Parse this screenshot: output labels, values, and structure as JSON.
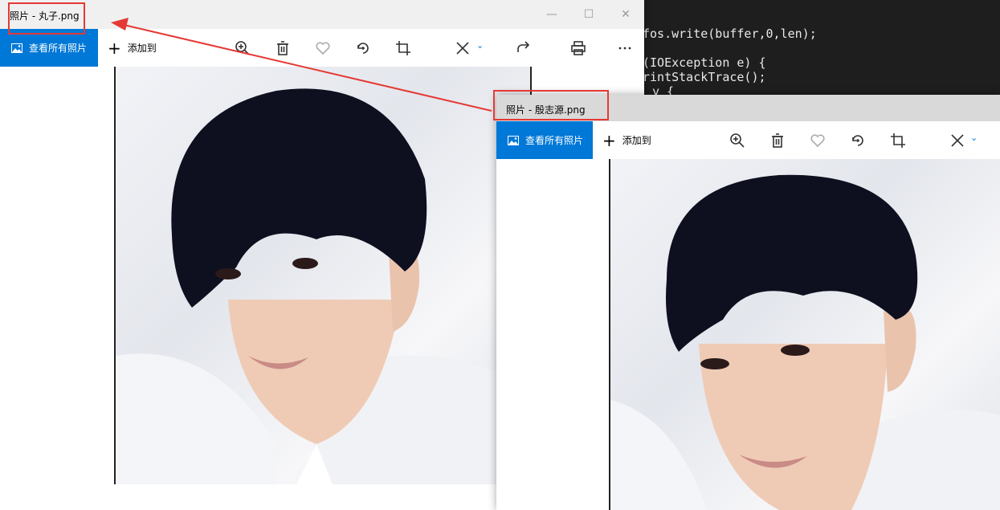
{
  "background_code": {
    "lines": [
      "fos.write(buffer,0,len);",
      "",
      "(IOException e) {",
      "rintStackTrace();",
      "y {"
    ]
  },
  "window1": {
    "title": "照片 - 丸子.png",
    "toolbar": {
      "view_all_label": "查看所有照片",
      "add_to_label": "添加到",
      "icons": [
        "zoom-icon",
        "delete-icon",
        "favorite-icon",
        "rotate-icon",
        "crop-icon",
        "edit-icon",
        "share-icon",
        "print-icon",
        "more-icon"
      ]
    },
    "window_controls": [
      "minimize",
      "maximize",
      "close"
    ]
  },
  "window2": {
    "title": "照片 - 殷志源.png",
    "toolbar": {
      "view_all_label": "查看所有照片",
      "add_to_label": "添加到",
      "icons": [
        "zoom-icon",
        "delete-icon",
        "favorite-icon",
        "rotate-icon",
        "crop-icon",
        "edit-icon"
      ]
    }
  },
  "colors": {
    "accent": "#0078d7",
    "annotation_red": "#e53935",
    "code_background": "#1e1e1e"
  }
}
